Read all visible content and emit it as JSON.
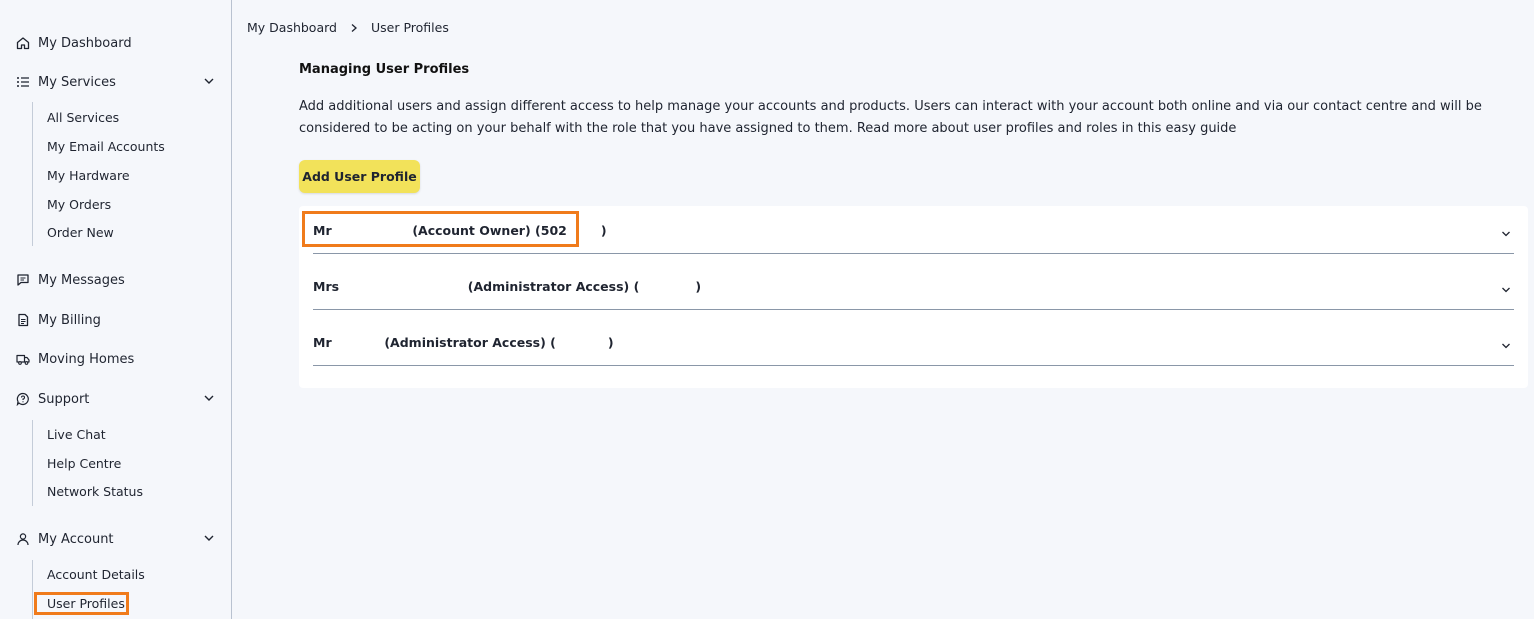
{
  "sidebar": {
    "dashboard": "My Dashboard",
    "services": {
      "label": "My Services",
      "items": [
        "All Services",
        "My Email Accounts",
        "My Hardware",
        "My Orders",
        "Order New"
      ]
    },
    "messages": "My Messages",
    "billing": "My Billing",
    "moving": "Moving Homes",
    "support": {
      "label": "Support",
      "items": [
        "Live Chat",
        "Help Centre",
        "Network Status"
      ]
    },
    "account": {
      "label": "My Account",
      "items": [
        "Account Details",
        "User Profiles"
      ]
    }
  },
  "breadcrumb": {
    "root": "My Dashboard",
    "current": "User Profiles"
  },
  "main": {
    "title": "Managing User Profiles",
    "description": "Add additional users and assign different access to help manage your accounts and products. Users can interact with your account both online and via our contact centre and will be considered to be acting on your behalf with the role that you have assigned to them. Read more about user profiles and roles in this easy guide",
    "add_button": "Add User Profile",
    "profiles": [
      {
        "prefix": "Mr",
        "role": "(Account Owner) (502",
        "suffix": ")"
      },
      {
        "prefix": "Mrs",
        "role": "(Administrator Access) (",
        "suffix": ")"
      },
      {
        "prefix": "Mr",
        "role": "(Administrator Access) (",
        "suffix": ")"
      }
    ]
  },
  "colors": {
    "accent_button": "#f2e25a",
    "highlight": "#f07b1b",
    "background": "#f5f7fb"
  }
}
